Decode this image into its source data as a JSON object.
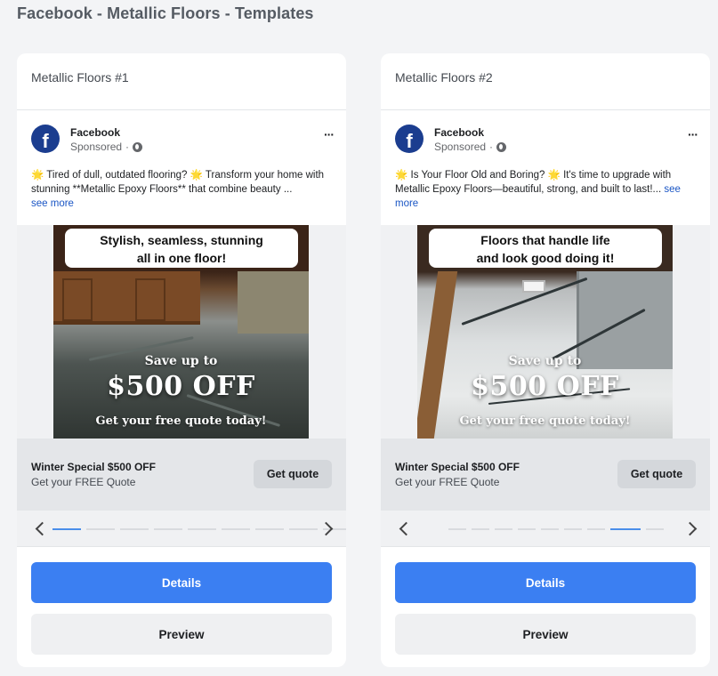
{
  "page": {
    "title": "Facebook - Metallic Floors - Templates"
  },
  "colors": {
    "primary": "#3b7ff2",
    "facebook_logo": "#1b3d8f",
    "active_dot": "#4a8eea"
  },
  "icons": {
    "logo": "facebook-f-icon",
    "globe": "globe-icon",
    "more": "ellipsis-icon",
    "prev": "chevron-left-icon",
    "next": "chevron-right-icon"
  },
  "cards": [
    {
      "name": "Metallic Floors #1",
      "page_name": "Facebook",
      "sponsored": "Sponsored",
      "ad_text": "🌟 Tired of dull, outdated flooring? 🌟 Transform your home with stunning **Metallic Epoxy Floors** that combine beauty ...",
      "see_more": "see more",
      "creative": {
        "headline_line1": "Stylish, seamless, stunning",
        "headline_line2": "all in one floor!",
        "save_up": "Save up to",
        "amount": "$500 OFF",
        "quote_line": "Get your free quote today!"
      },
      "offer_title": "Winter Special $500 OFF",
      "offer_subtitle": "Get your FREE Quote",
      "cta_label": "Get quote",
      "carousel": {
        "slide_count": 9,
        "active_index": 0
      },
      "details_label": "Details",
      "preview_label": "Preview"
    },
    {
      "name": "Metallic Floors #2",
      "page_name": "Facebook",
      "sponsored": "Sponsored",
      "ad_text": "🌟 Is Your Floor Old and Boring? 🌟 It's time to upgrade with Metallic Epoxy Floors—beautiful, strong, and built to last!...",
      "see_more": "see more",
      "creative": {
        "headline_line1": "Floors that handle life",
        "headline_line2": "and look good doing it!",
        "save_up": "Save up to",
        "amount": "$500 OFF",
        "quote_line": "Get your free quote today!"
      },
      "offer_title": "Winter Special $500 OFF",
      "offer_subtitle": "Get your FREE Quote",
      "cta_label": "Get quote",
      "carousel": {
        "slide_count": 9,
        "active_index": 7
      },
      "details_label": "Details",
      "preview_label": "Preview"
    }
  ]
}
